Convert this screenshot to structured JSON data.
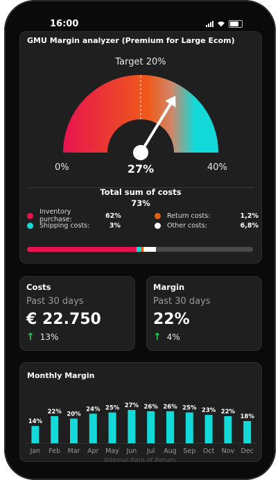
{
  "status_bar": {
    "time": "16:00"
  },
  "gauge": {
    "title": "GMU Margin analyzer (Premium for Large Ecom)",
    "target_label": "Target 20%",
    "min_label": "0%",
    "max_label": "40%",
    "value_label": "27%",
    "value": 27,
    "target": 20,
    "max": 40,
    "colors": {
      "start": "#e8134e",
      "mid": "#ee5a1a",
      "end": "#13d9d9"
    }
  },
  "costs_breakdown": {
    "title": "Total sum of costs",
    "total": "73%",
    "items": [
      {
        "name": "Inventory purchase:",
        "pct": "62%",
        "value": 62,
        "color": "#e8134e"
      },
      {
        "name": "Return costs:",
        "pct": "1,2%",
        "value": 1.2,
        "color": "#e65c12"
      },
      {
        "name": "Shipping costs:",
        "pct": "3%",
        "value": 3,
        "color": "#13d9d9"
      },
      {
        "name": "Other costs:",
        "pct": "6,8%",
        "value": 6.8,
        "color": "#ffffff"
      }
    ]
  },
  "costs_card": {
    "title": "Costs",
    "subtitle": "Past 30 days",
    "value": "€ 22.750",
    "trend": "13%"
  },
  "margin_card": {
    "title": "Margin",
    "subtitle": "Past 30 days",
    "value": "22%",
    "trend": "4%"
  },
  "monthly": {
    "title": "Monthly Margin",
    "bar_color": "#13d9d9"
  },
  "bottom_text": "Internal Rate of Return",
  "chart_data": {
    "type": "bar",
    "title": "Monthly Margin",
    "categories": [
      "Jan",
      "Feb",
      "Mar",
      "Apr",
      "May",
      "Jun",
      "Jul",
      "Aug",
      "Sep",
      "Oct",
      "Nov",
      "Dec"
    ],
    "values": [
      14,
      22,
      20,
      24,
      25,
      27,
      26,
      26,
      25,
      23,
      22,
      18
    ],
    "labels": [
      "14%",
      "22%",
      "20%",
      "24%",
      "25%",
      "27%",
      "26%",
      "26%",
      "25%",
      "23%",
      "22%",
      "18%"
    ],
    "ylim": [
      0,
      30
    ]
  }
}
